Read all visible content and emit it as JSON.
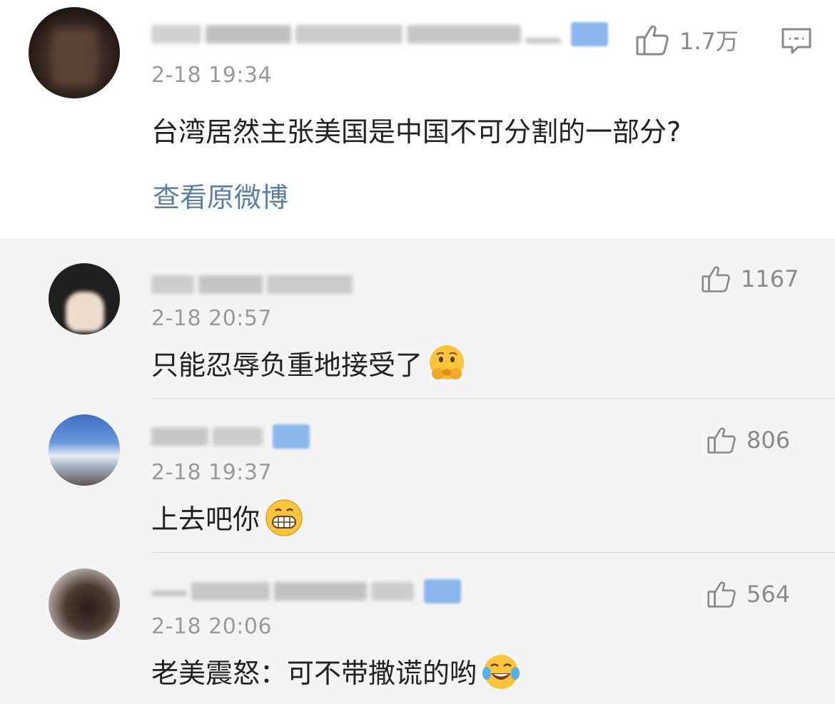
{
  "post": {
    "time": "2-18 19:34",
    "text": "台湾居然主张美国是中国不可分割的一部分?",
    "view_original": "查看原微博",
    "likes": "1.7万",
    "comment_icon": "comment-icon",
    "like_icon": "thumbs-up-icon",
    "verified_badge": true
  },
  "replies": [
    {
      "time": "2-18 20:57",
      "text": "只能忍辱负重地接受了",
      "emoji": "pleading-face-emoji",
      "likes": "1167",
      "verified_badge": false
    },
    {
      "time": "2-18 19:37",
      "text": "上去吧你",
      "emoji": "grinning-teeth-emoji",
      "likes": "806",
      "verified_badge": true
    },
    {
      "time": "2-18 20:06",
      "text": "老美震怒：可不带撒谎的哟",
      "emoji": "tears-of-joy-emoji",
      "likes": "564",
      "verified_badge": true
    }
  ],
  "colors": {
    "link": "#5b80a8",
    "badge": "#8cb7ee",
    "meta": "#9a9a9a",
    "reply_background": "#f4f4f4"
  }
}
